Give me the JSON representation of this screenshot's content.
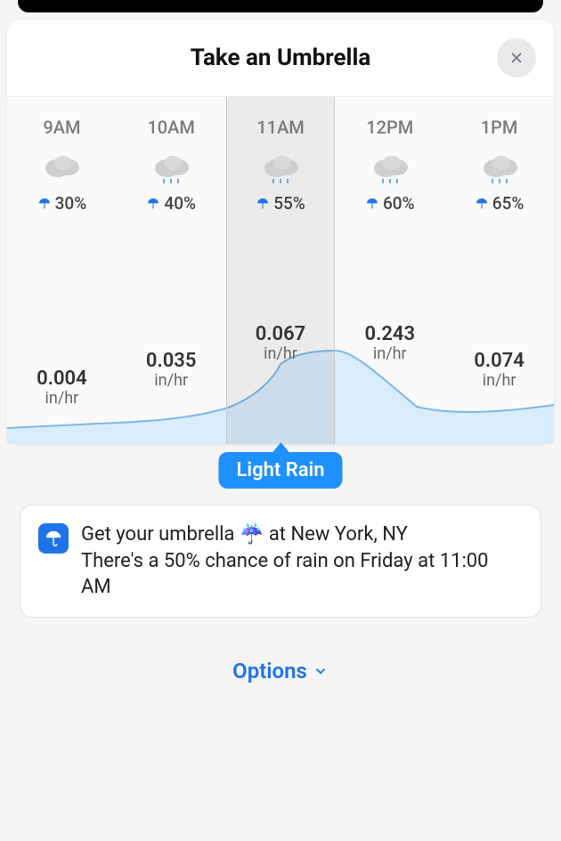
{
  "header": {
    "title": "Take an Umbrella"
  },
  "selectedIndex": 2,
  "hours": [
    {
      "time": "9AM",
      "precip": "30%",
      "rate": "0.004",
      "unit": "in/hr",
      "icon": "cloud",
      "labelBottom": 305
    },
    {
      "time": "10AM",
      "precip": "40%",
      "rate": "0.035",
      "unit": "in/hr",
      "icon": "cloud-rain",
      "labelBottom": 285
    },
    {
      "time": "11AM",
      "precip": "55%",
      "rate": "0.067",
      "unit": "in/hr",
      "icon": "cloud-rain",
      "labelBottom": 255
    },
    {
      "time": "12PM",
      "precip": "60%",
      "rate": "0.243",
      "unit": "in/hr",
      "icon": "cloud-rain",
      "labelBottom": 255
    },
    {
      "time": "1PM",
      "precip": "65%",
      "rate": "0.074",
      "unit": "in/hr",
      "icon": "cloud-rain",
      "labelBottom": 285
    }
  ],
  "badge": {
    "label": "Light Rain"
  },
  "notification": {
    "line1a": "Get your umbrella ",
    "line1b": " at New York, NY",
    "line2": "There's a 50% chance of rain on Friday at 11:00 AM"
  },
  "options_label": "Options",
  "chart_data": {
    "type": "area",
    "title": "Precipitation rate by hour",
    "xlabel": "",
    "ylabel": "in/hr",
    "ylim": [
      0,
      0.3
    ],
    "categories": [
      "9AM",
      "10AM",
      "11AM",
      "12PM",
      "1PM"
    ],
    "series": [
      {
        "name": "precip_probability_pct",
        "values": [
          30,
          40,
          55,
          60,
          65
        ]
      },
      {
        "name": "precip_rate_in_per_hr",
        "values": [
          0.004,
          0.035,
          0.067,
          0.243,
          0.074
        ]
      }
    ]
  }
}
